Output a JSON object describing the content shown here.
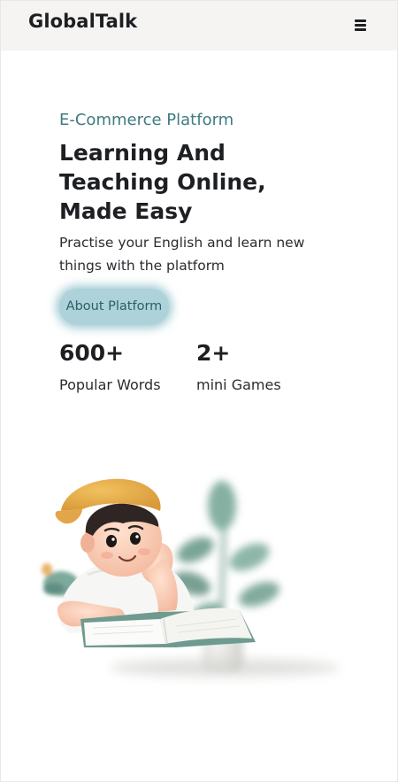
{
  "header": {
    "brand": "GlobalTalk",
    "menu_icon": "hamburger-menu-icon"
  },
  "hero": {
    "eyebrow": "E-Commerce Platform",
    "headline_line1": "Learning And",
    "headline_line2": "Teaching Online,",
    "headline_line3": "Made Easy",
    "subtext": "Practise your English and learn new things with the platform",
    "cta_label": "About Platform"
  },
  "stats": [
    {
      "value": "600+",
      "label": "Popular Words"
    },
    {
      "value": "2+",
      "label": "mini Games"
    }
  ],
  "illustration": {
    "icon": "boy-reading-book-illustration"
  },
  "colors": {
    "accent": "#3f7b80",
    "cta_background": "#aed2da",
    "cta_text": "#2d5d66",
    "navbar_background": "#f5f4f2",
    "heading": "#1d1f22"
  }
}
